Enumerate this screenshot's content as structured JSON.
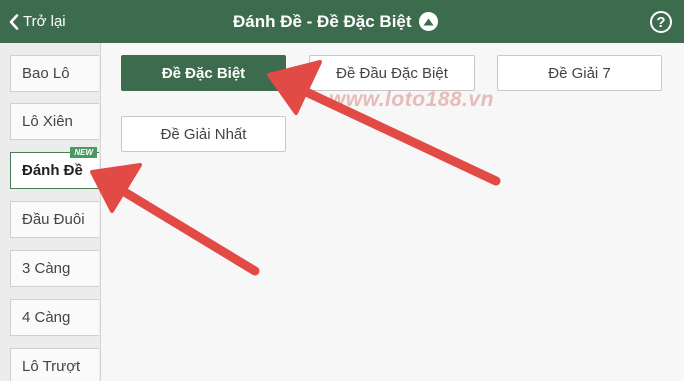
{
  "header": {
    "back_label": "Trở lại",
    "title": "Đánh Đề - Đề Đặc Biệt",
    "help_symbol": "?"
  },
  "sidebar": {
    "items": [
      {
        "label": "Bao Lô",
        "active": false
      },
      {
        "label": "Lô Xiên",
        "active": false
      },
      {
        "label": "Đánh Đề",
        "active": true,
        "badge": "NEW"
      },
      {
        "label": "Đầu Đuôi",
        "active": false
      },
      {
        "label": "3 Càng",
        "active": false
      },
      {
        "label": "4 Càng",
        "active": false
      },
      {
        "label": "Lô Trượt",
        "active": false
      }
    ]
  },
  "main": {
    "options": [
      {
        "label": "Đề Đặc Biệt",
        "active": true
      },
      {
        "label": "Đề Đầu Đặc Biệt",
        "active": false
      },
      {
        "label": "Đề Giải 7",
        "active": false
      },
      {
        "label": "Đề Giải Nhất",
        "active": false
      }
    ],
    "watermark": "www.loto188.vn"
  },
  "colors": {
    "header_bg": "#3d6b4e",
    "active_button_bg": "#3d6b4e",
    "badge_bg": "#4a9a60",
    "arrow": "#e24a45"
  },
  "annotations": {
    "arrows": [
      "arrow-to-de-dac-biet",
      "arrow-to-danh-de"
    ]
  }
}
